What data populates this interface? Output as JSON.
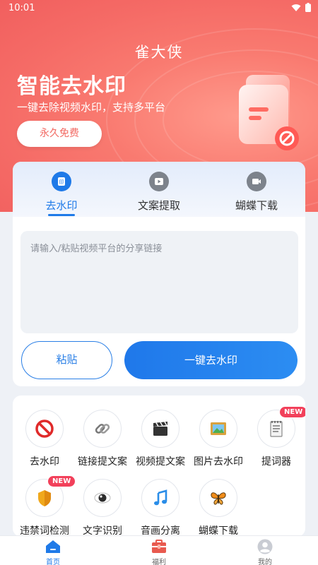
{
  "status_bar": {
    "time": "10:01"
  },
  "header": {
    "app_title": "雀大侠",
    "headline": "智能去水印",
    "subline": "一键去除视频水印，支持多平台",
    "free_button": "永久免费"
  },
  "tool": {
    "tabs": [
      {
        "label": "去水印",
        "icon": "watermark-icon",
        "active": true
      },
      {
        "label": "文案提取",
        "icon": "video-copy-icon",
        "active": false
      },
      {
        "label": "蝴蝶下载",
        "icon": "camera-download-icon",
        "active": false
      }
    ],
    "input_placeholder": "请输入/粘贴视频平台的分享链接",
    "input_value": "",
    "paste_button": "粘贴",
    "action_button": "一键去水印"
  },
  "features": [
    {
      "label": "去水印",
      "icon": "prohibited-icon"
    },
    {
      "label": "链接提文案",
      "icon": "link-icon"
    },
    {
      "label": "视频提文案",
      "icon": "clapper-icon"
    },
    {
      "label": "图片去水印",
      "icon": "picture-icon"
    },
    {
      "label": "提词器",
      "icon": "notepad-icon",
      "badge": "NEW"
    },
    {
      "label": "违禁词检测",
      "icon": "shield-icon",
      "badge": "NEW"
    },
    {
      "label": "文字识别",
      "icon": "eye-icon"
    },
    {
      "label": "音画分离",
      "icon": "music-note-icon"
    },
    {
      "label": "蝴蝶下载",
      "icon": "butterfly-icon"
    }
  ],
  "bottom_nav": [
    {
      "label": "首页",
      "icon": "home-icon",
      "active": true
    },
    {
      "label": "福利",
      "icon": "gift-box-icon",
      "active": false
    },
    {
      "label": "我的",
      "icon": "profile-icon",
      "active": false
    }
  ],
  "colors": {
    "hero": "#f56b66",
    "accent": "#1f7ae8",
    "badge": "#f2405a"
  }
}
